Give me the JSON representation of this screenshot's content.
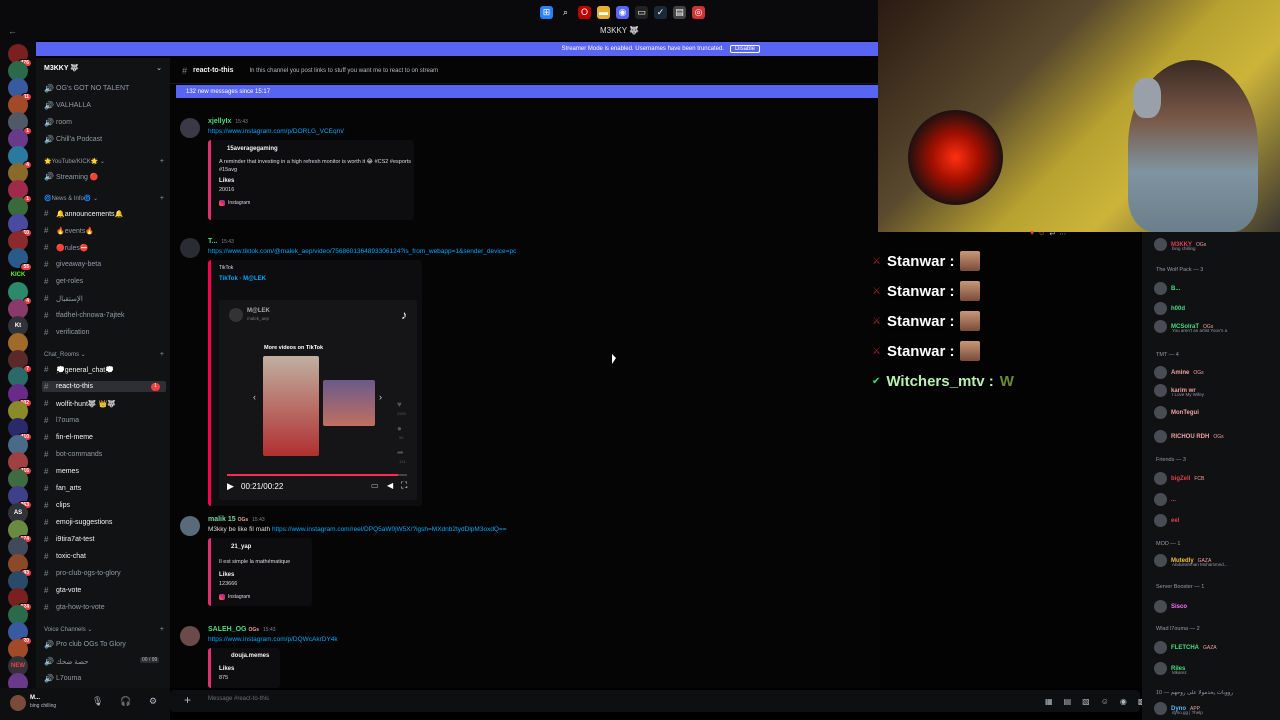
{
  "window": {
    "title": "M3KKY 🐺"
  },
  "streamer_bar": {
    "text": "Streamer Mode is enabled. Usernames have been truncated.",
    "button": "Disable"
  },
  "guild": {
    "name": "M3KKY 🐺"
  },
  "channels": {
    "top": [
      "OG's GOT NO TALENT",
      "VALHALLA",
      "room",
      "Chill'a Podcast"
    ],
    "youtube_cat": "🌟YouTube/KICK🌟",
    "youtube": [
      "Streaming 🔴"
    ],
    "news_cat": "🌀News & Info🌀",
    "news": [
      "🔔announcements🔔",
      "🔥events🔥",
      "🔴rules⛔",
      "giveaway-beta",
      "get-roles",
      "الإستقبال",
      "tfadhel-chnowa-7ajtek",
      "verification"
    ],
    "chat_cat": "Chat_Rooms",
    "chat": [
      "💭general_chat💭",
      "react-to-this",
      "wolfit-hunt🐺 👑🐺",
      "l7ouma",
      "fin-el-meme",
      "bot-commands",
      "memes",
      "fan_arts",
      "clips",
      "emoji-suggestions",
      "i9tira7at-test",
      "toxic-chat",
      "pro-club-ogs-to-glory",
      "gta-vote",
      "gta-how-to-vote"
    ],
    "voice_cat": "Voice Channels",
    "voice": [
      "Pro club OGs To Glory",
      "حصة ضحك",
      "L7ouma"
    ],
    "voice_counts": "00 / 99",
    "unread_count": "1"
  },
  "server_badges": [
    "476",
    "11",
    "1",
    "4",
    "1",
    "10",
    "55",
    "4",
    "7",
    "102",
    "410",
    "116",
    "263",
    "174",
    "93",
    "124",
    "20"
  ],
  "server_labels": [
    "KICK",
    "Kt",
    "AS",
    "NEW"
  ],
  "user": {
    "name": "M...",
    "status": "bing chilling"
  },
  "chat": {
    "channel": "react-to-this",
    "topic": "In this channel you post links to stuff you want me to react to on stream",
    "new_messages": "132 new messages since 15:17",
    "composer_placeholder": "Message #react-to-this",
    "messages": [
      {
        "user": "xjellyIx",
        "time": "15:43",
        "link": "https://www.instagram.com/p/DORLG_VCEqm/",
        "embed": {
          "author": "15averagegaming",
          "text": "A reminder that investing in a high refresh monitor is worth it 😂 #CS2 #esports #15avg",
          "likes_label": "Likes",
          "likes": "20016",
          "footer": "Instagram"
        }
      },
      {
        "user": "T...",
        "time": "15:43",
        "link": "https://www.tiktok.com/@malek_aep/video/7568601364893306124?is_from_webapp=1&sender_device=pc",
        "embed": {
          "provider": "TikTok",
          "title": "TikTok · M@LEK",
          "video_user": "M@LEK",
          "video_handle": "malek_aep",
          "more": "More videos on TikTok",
          "time": "00:21/00:22",
          "counts": [
            "2665",
            "55",
            "131"
          ]
        }
      },
      {
        "user": "malik 15",
        "tag": "OGs",
        "time": "15:43",
        "text": "M3kky be like fil math ",
        "link": "https://www.instagram.com/reel/DPQ5aW0jW5X/?igsh=MXdnb2tydDlpM3oxdQ==",
        "embed": {
          "author": "21_yap",
          "text": "Il est simple la mathématique",
          "likes_label": "Likes",
          "likes": "123666",
          "footer": "Instagram"
        }
      },
      {
        "user": "SALEH_OG",
        "tag": "OGs",
        "time": "15:43",
        "link": "https://www.instagram.com/p/DQWcAkrDY4k",
        "embed": {
          "author": "douja.memes",
          "likes_label": "Likes",
          "likes": "875"
        }
      }
    ]
  },
  "overlay": {
    "lines": [
      "Stanwar",
      "Stanwar",
      "Stanwar",
      "Stanwar"
    ],
    "last": "Witchers_mtv"
  },
  "members": {
    "top_user": "M3KKY",
    "top_tag": "OGs",
    "top_status": "bing chilling",
    "wolf_pack": "The Wolf Pack — 3",
    "wolf": [
      "B...",
      "h00d",
      "MCSolraT"
    ],
    "wolf_tag": "OGs",
    "wolf_status": "You aren't an artist Yoov's a",
    "tmt": "TMT — 4",
    "tmt_members": [
      "Amine",
      "karim wr",
      "MonTegui",
      "RICHOU RDH"
    ],
    "tmt_tag": "OGs",
    "karim_status": "I Love My Wifey",
    "friends": "Friends — 3",
    "friends_members": [
      "bigZell",
      "...",
      "eel"
    ],
    "friends_tag": "FCB",
    "mod": "MOD — 1",
    "mod_user": "Mutedly",
    "mod_tag": "GAZA",
    "mod_status": "Abdulrahman Mohammed...",
    "booster": "Server Booster — 1",
    "booster_user": "Sisco",
    "l7ouma": "Wlad l7ouma — 2",
    "l7ouma_members": [
      "FLETCHA",
      "Riles"
    ],
    "l7ouma_tag": "GAZA",
    "riles_status": "Mkarez",
    "arabic": "رووبات يخدمولا على روحهم — 10",
    "dyno": "Dyno",
    "dyno_tag": "APP",
    "dyno_status": "dyno.gg | ?help"
  }
}
